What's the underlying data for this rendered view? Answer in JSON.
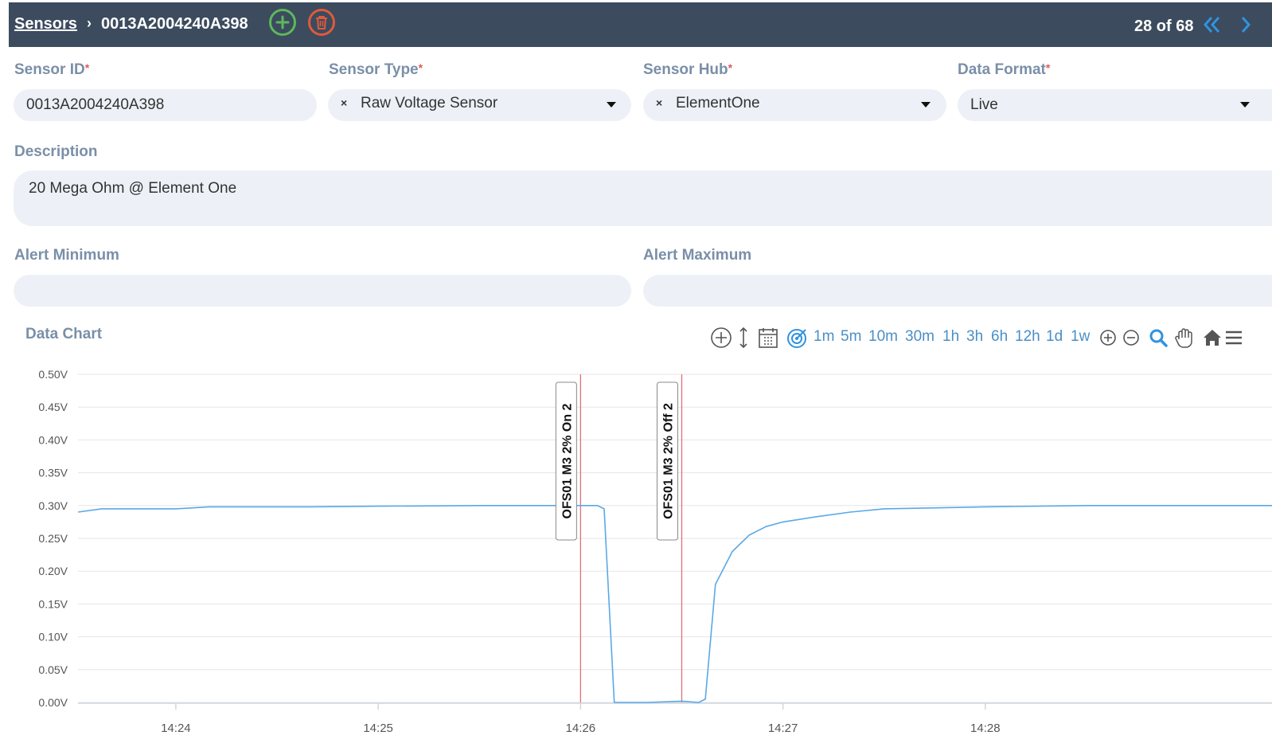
{
  "header": {
    "breadcrumb_root": "Sensors",
    "breadcrumb_separator": "›",
    "breadcrumb_current": "0013A2004240A398",
    "pager": "28 of 68"
  },
  "form": {
    "sensor_id": {
      "label": "Sensor ID",
      "value": "0013A2004240A398"
    },
    "sensor_type": {
      "label": "Sensor Type",
      "value": "Raw Voltage Sensor"
    },
    "sensor_hub": {
      "label": "Sensor Hub",
      "value": "ElementOne"
    },
    "data_format": {
      "label": "Data Format",
      "value": "Live"
    },
    "description": {
      "label": "Description",
      "value": "20 Mega Ohm @ Element One"
    },
    "alert_minimum": {
      "label": "Alert Minimum",
      "value": ""
    },
    "alert_maximum": {
      "label": "Alert Maximum",
      "value": ""
    },
    "required_marker": "*",
    "clear_glyph": "×"
  },
  "chart_toolbar": {
    "title": "Data Chart",
    "ranges": [
      "1m",
      "5m",
      "10m",
      "30m",
      "1h",
      "3h",
      "6h",
      "12h",
      "1d",
      "1w"
    ],
    "icons": [
      "plus-circle-icon",
      "resize-vertical-icon",
      "calendar-icon",
      "target-icon",
      "zoom-in-icon",
      "zoom-out-icon",
      "search-zoom-icon",
      "pan-hand-icon",
      "home-icon",
      "menu-icon"
    ]
  },
  "chart_data": {
    "type": "line",
    "title": "",
    "ylabel": "",
    "xlabel": "",
    "ylim": [
      0,
      0.5
    ],
    "y_ticks": [
      "0.00V",
      "0.05V",
      "0.10V",
      "0.15V",
      "0.20V",
      "0.25V",
      "0.30V",
      "0.35V",
      "0.40V",
      "0.45V",
      "0.50V"
    ],
    "x_ticks": [
      "14:24",
      "14:25",
      "14:26",
      "14:27",
      "14:28"
    ],
    "x_unit": "minutes",
    "xlim": [
      "14:23:31",
      "14:29:25"
    ],
    "grid": true,
    "color": "#5aa9e6",
    "series": [
      {
        "x": [
          "14:23:31",
          "14:23:38",
          "14:23:45",
          "14:24:00",
          "14:24:10",
          "14:24:20",
          "14:24:40",
          "14:25:00",
          "14:25:30",
          "14:25:50",
          "14:26:00",
          "14:26:05",
          "14:26:07",
          "14:26:10",
          "14:26:20",
          "14:26:30",
          "14:26:35",
          "14:26:37",
          "14:26:40",
          "14:26:45",
          "14:26:50",
          "14:26:55",
          "14:27:00",
          "14:27:10",
          "14:27:20",
          "14:27:30",
          "14:27:50",
          "14:28:00",
          "14:28:30",
          "14:29:00",
          "14:29:25"
        ],
        "y": [
          0.29,
          0.295,
          0.295,
          0.295,
          0.298,
          0.298,
          0.298,
          0.299,
          0.3,
          0.3,
          0.3,
          0.3,
          0.295,
          0.0,
          0.0,
          0.002,
          0.0,
          0.005,
          0.18,
          0.23,
          0.255,
          0.268,
          0.275,
          0.283,
          0.29,
          0.295,
          0.297,
          0.298,
          0.3,
          0.3,
          0.3
        ]
      }
    ],
    "annotations": [
      {
        "x": "14:26:00",
        "label": "OFS01 M3 2% On 2"
      },
      {
        "x": "14:26:30",
        "label": "OFS01 M3 2% Off 2"
      }
    ]
  }
}
